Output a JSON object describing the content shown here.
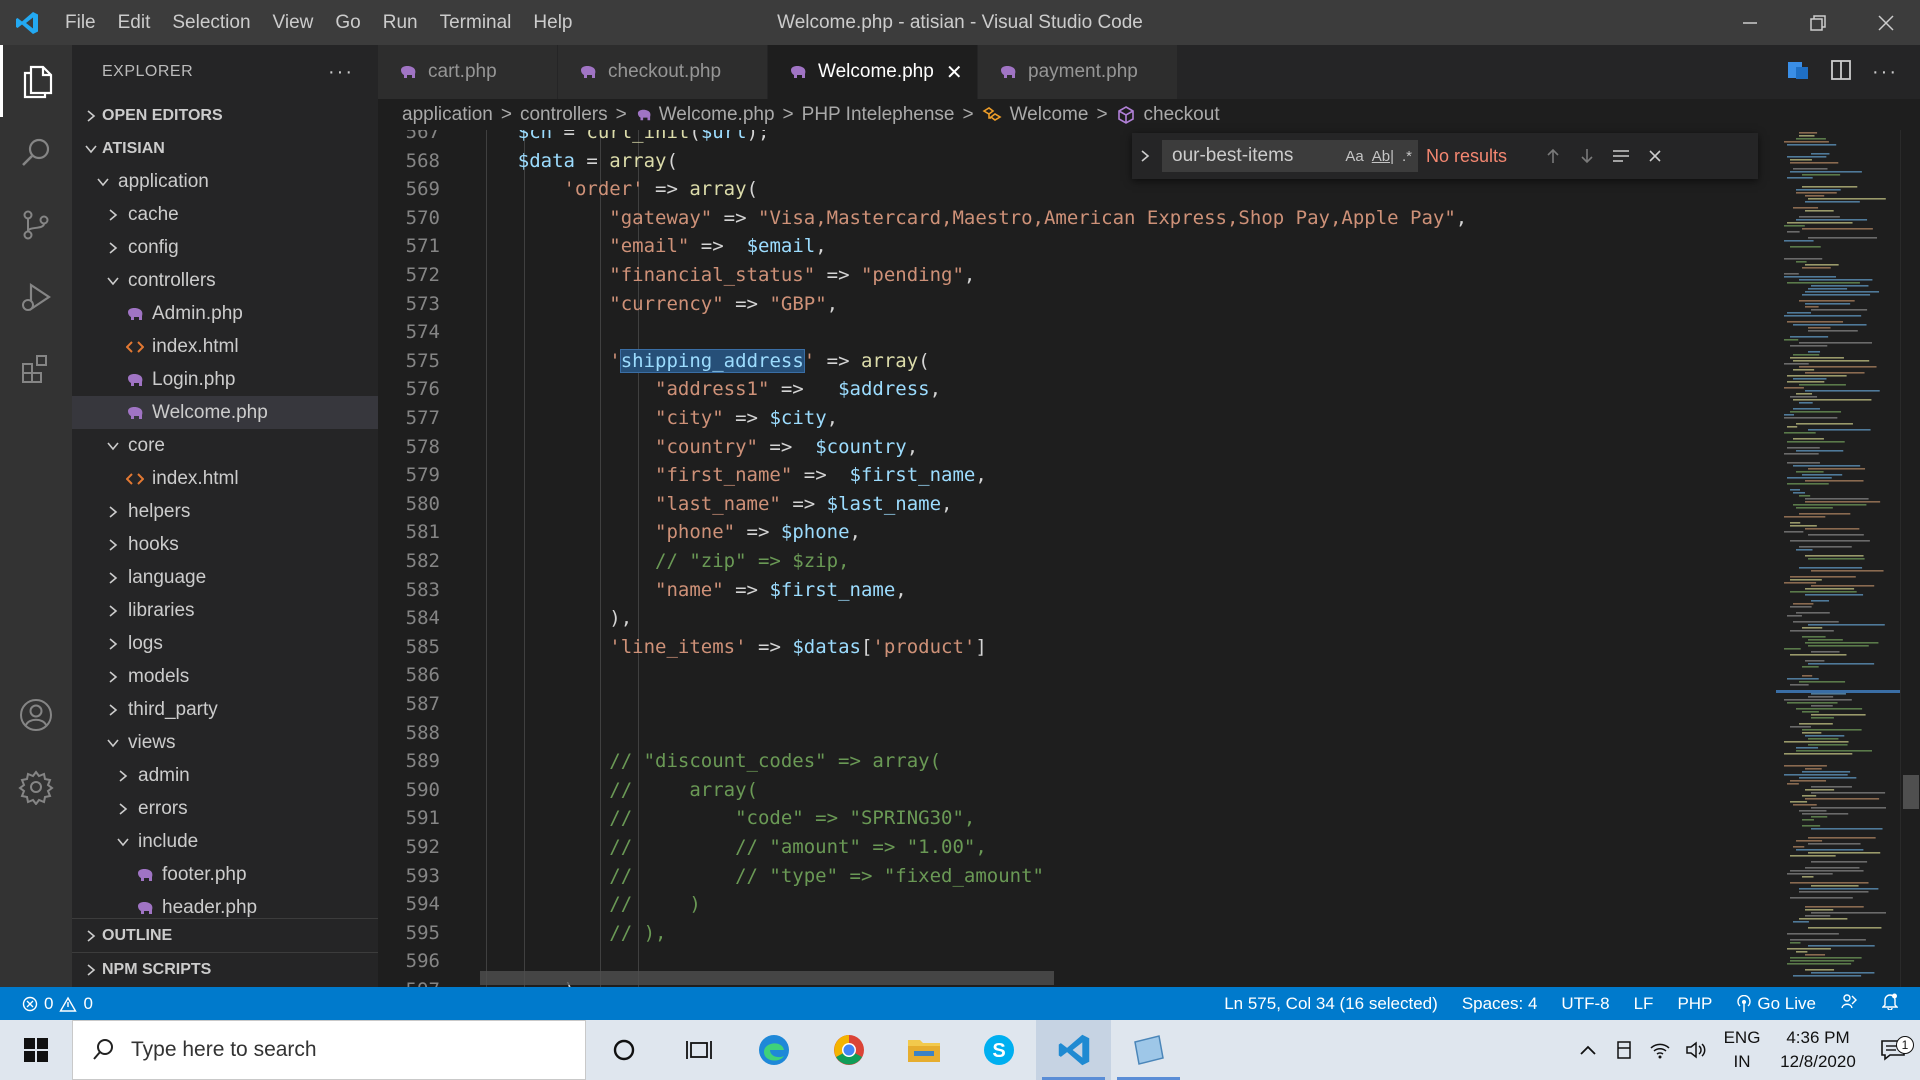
{
  "titlebar": {
    "menu": [
      "File",
      "Edit",
      "Selection",
      "View",
      "Go",
      "Run",
      "Terminal",
      "Help"
    ],
    "window_title": "Welcome.php - atisian - Visual Studio Code"
  },
  "sidebar": {
    "title": "EXPLORER",
    "more": "···",
    "open_editors": "OPEN EDITORS",
    "workspace": "ATISIAN",
    "tree": [
      {
        "label": "application",
        "depth": 0,
        "kind": "folder-open"
      },
      {
        "label": "cache",
        "depth": 1,
        "kind": "folder"
      },
      {
        "label": "config",
        "depth": 1,
        "kind": "folder"
      },
      {
        "label": "controllers",
        "depth": 1,
        "kind": "folder-open"
      },
      {
        "label": "Admin.php",
        "depth": 2,
        "kind": "php"
      },
      {
        "label": "index.html",
        "depth": 2,
        "kind": "html"
      },
      {
        "label": "Login.php",
        "depth": 2,
        "kind": "php"
      },
      {
        "label": "Welcome.php",
        "depth": 2,
        "kind": "php",
        "selected": true
      },
      {
        "label": "core",
        "depth": 1,
        "kind": "folder-open"
      },
      {
        "label": "index.html",
        "depth": 2,
        "kind": "html"
      },
      {
        "label": "helpers",
        "depth": 1,
        "kind": "folder"
      },
      {
        "label": "hooks",
        "depth": 1,
        "kind": "folder"
      },
      {
        "label": "language",
        "depth": 1,
        "kind": "folder"
      },
      {
        "label": "libraries",
        "depth": 1,
        "kind": "folder"
      },
      {
        "label": "logs",
        "depth": 1,
        "kind": "folder"
      },
      {
        "label": "models",
        "depth": 1,
        "kind": "folder"
      },
      {
        "label": "third_party",
        "depth": 1,
        "kind": "folder"
      },
      {
        "label": "views",
        "depth": 1,
        "kind": "folder-open"
      },
      {
        "label": "admin",
        "depth": 2,
        "kind": "folder"
      },
      {
        "label": "errors",
        "depth": 2,
        "kind": "folder"
      },
      {
        "label": "include",
        "depth": 2,
        "kind": "folder-open"
      },
      {
        "label": "footer.php",
        "depth": 3,
        "kind": "php"
      },
      {
        "label": "header.php",
        "depth": 3,
        "kind": "php"
      }
    ],
    "outline": "OUTLINE",
    "npm_scripts": "NPM SCRIPTS"
  },
  "tabs": [
    {
      "label": "cart.php",
      "active": false
    },
    {
      "label": "checkout.php",
      "active": false
    },
    {
      "label": "Welcome.php",
      "active": true
    },
    {
      "label": "payment.php",
      "active": false
    }
  ],
  "tab_close": "✕",
  "breadcrumbs": {
    "items": [
      "application",
      "controllers",
      "Welcome.php",
      "PHP Intelephense",
      "Welcome",
      "checkout"
    ],
    "separator": ">"
  },
  "find_widget": {
    "query": "our-best-items",
    "match_case": "Aa",
    "whole_word": "Ab|",
    "regex": ".*",
    "results": "No results"
  },
  "code": {
    "lines": [
      {
        "n": "567",
        "tokens": [
          [
            "pl",
            "    "
          ],
          [
            "var",
            "$ch"
          ],
          [
            "pl",
            " = "
          ],
          [
            "fn",
            "curl_init"
          ],
          [
            "pl",
            "("
          ],
          [
            "var",
            "$url"
          ],
          [
            "pl",
            ");"
          ]
        ],
        "top": true
      },
      {
        "n": "568",
        "tokens": [
          [
            "pl",
            "    "
          ],
          [
            "var",
            "$data"
          ],
          [
            "pl",
            " = "
          ],
          [
            "fn",
            "array"
          ],
          [
            "pl",
            "("
          ]
        ]
      },
      {
        "n": "569",
        "tokens": [
          [
            "pl",
            "        "
          ],
          [
            "str",
            "'order'"
          ],
          [
            "pl",
            " => "
          ],
          [
            "fn",
            "array"
          ],
          [
            "pl",
            "("
          ]
        ]
      },
      {
        "n": "570",
        "tokens": [
          [
            "pl",
            "            "
          ],
          [
            "str",
            "\"gateway\""
          ],
          [
            "pl",
            " => "
          ],
          [
            "str",
            "\"Visa,Mastercard,Maestro,American Express,Shop Pay,Apple Pay\""
          ],
          [
            "pl",
            ","
          ]
        ]
      },
      {
        "n": "571",
        "tokens": [
          [
            "pl",
            "            "
          ],
          [
            "str",
            "\"email\""
          ],
          [
            "pl",
            " =>  "
          ],
          [
            "var",
            "$email"
          ],
          [
            "pl",
            ","
          ]
        ]
      },
      {
        "n": "572",
        "tokens": [
          [
            "pl",
            "            "
          ],
          [
            "str",
            "\"financial_status\""
          ],
          [
            "pl",
            " => "
          ],
          [
            "str",
            "\"pending\""
          ],
          [
            "pl",
            ","
          ]
        ]
      },
      {
        "n": "573",
        "tokens": [
          [
            "pl",
            "            "
          ],
          [
            "str",
            "\"currency\""
          ],
          [
            "pl",
            " => "
          ],
          [
            "str",
            "\"GBP\""
          ],
          [
            "pl",
            ","
          ]
        ]
      },
      {
        "n": "574",
        "tokens": [
          [
            "pl",
            ""
          ]
        ]
      },
      {
        "n": "575",
        "tokens": [
          [
            "pl",
            "            "
          ],
          [
            "str",
            "'"
          ],
          [
            "sel",
            "shipping_address"
          ],
          [
            "str",
            "'"
          ],
          [
            "pl",
            " => "
          ],
          [
            "fn",
            "array"
          ],
          [
            "pl",
            "("
          ]
        ]
      },
      {
        "n": "576",
        "tokens": [
          [
            "pl",
            "                "
          ],
          [
            "str",
            "\"address1\""
          ],
          [
            "pl",
            " =>   "
          ],
          [
            "var",
            "$address"
          ],
          [
            "pl",
            ","
          ]
        ]
      },
      {
        "n": "577",
        "tokens": [
          [
            "pl",
            "                "
          ],
          [
            "str",
            "\"city\""
          ],
          [
            "pl",
            " => "
          ],
          [
            "var",
            "$city"
          ],
          [
            "pl",
            ","
          ]
        ]
      },
      {
        "n": "578",
        "tokens": [
          [
            "pl",
            "                "
          ],
          [
            "str",
            "\"country\""
          ],
          [
            "pl",
            " =>  "
          ],
          [
            "var",
            "$country"
          ],
          [
            "pl",
            ","
          ]
        ]
      },
      {
        "n": "579",
        "tokens": [
          [
            "pl",
            "                "
          ],
          [
            "str",
            "\"first_name\""
          ],
          [
            "pl",
            " =>  "
          ],
          [
            "var",
            "$first_name"
          ],
          [
            "pl",
            ","
          ]
        ]
      },
      {
        "n": "580",
        "tokens": [
          [
            "pl",
            "                "
          ],
          [
            "str",
            "\"last_name\""
          ],
          [
            "pl",
            " => "
          ],
          [
            "var",
            "$last_name"
          ],
          [
            "pl",
            ","
          ]
        ]
      },
      {
        "n": "581",
        "tokens": [
          [
            "pl",
            "                "
          ],
          [
            "str",
            "\"phone\""
          ],
          [
            "pl",
            " => "
          ],
          [
            "var",
            "$phone"
          ],
          [
            "pl",
            ","
          ]
        ]
      },
      {
        "n": "582",
        "tokens": [
          [
            "pl",
            "                "
          ],
          [
            "cmt",
            "// \"zip\" => $zip,"
          ]
        ]
      },
      {
        "n": "583",
        "tokens": [
          [
            "pl",
            "                "
          ],
          [
            "str",
            "\"name\""
          ],
          [
            "pl",
            " => "
          ],
          [
            "var",
            "$first_name"
          ],
          [
            "pl",
            ","
          ]
        ]
      },
      {
        "n": "584",
        "tokens": [
          [
            "pl",
            "            ),"
          ]
        ]
      },
      {
        "n": "585",
        "tokens": [
          [
            "pl",
            "            "
          ],
          [
            "str",
            "'line_items'"
          ],
          [
            "pl",
            " => "
          ],
          [
            "var",
            "$datas"
          ],
          [
            "pl",
            "["
          ],
          [
            "str",
            "'product'"
          ],
          [
            "pl",
            "]"
          ]
        ]
      },
      {
        "n": "586",
        "tokens": [
          [
            "pl",
            ""
          ]
        ]
      },
      {
        "n": "587",
        "tokens": [
          [
            "pl",
            ""
          ]
        ]
      },
      {
        "n": "588",
        "tokens": [
          [
            "pl",
            ""
          ]
        ]
      },
      {
        "n": "589",
        "tokens": [
          [
            "pl",
            "            "
          ],
          [
            "cmt",
            "// \"discount_codes\" => array("
          ]
        ]
      },
      {
        "n": "590",
        "tokens": [
          [
            "pl",
            "            "
          ],
          [
            "cmt",
            "//     array("
          ]
        ]
      },
      {
        "n": "591",
        "tokens": [
          [
            "pl",
            "            "
          ],
          [
            "cmt",
            "//         \"code\" => \"SPRING30\","
          ]
        ]
      },
      {
        "n": "592",
        "tokens": [
          [
            "pl",
            "            "
          ],
          [
            "cmt",
            "//         // \"amount\" => \"1.00\","
          ]
        ]
      },
      {
        "n": "593",
        "tokens": [
          [
            "pl",
            "            "
          ],
          [
            "cmt",
            "//         // \"type\" => \"fixed_amount\""
          ]
        ]
      },
      {
        "n": "594",
        "tokens": [
          [
            "pl",
            "            "
          ],
          [
            "cmt",
            "//     )"
          ]
        ]
      },
      {
        "n": "595",
        "tokens": [
          [
            "pl",
            "            "
          ],
          [
            "cmt",
            "// ),"
          ]
        ]
      },
      {
        "n": "596",
        "tokens": [
          [
            "pl",
            ""
          ]
        ]
      },
      {
        "n": "597",
        "tokens": [
          [
            "pl",
            "        ),"
          ]
        ]
      }
    ]
  },
  "statusbar": {
    "errors": "0",
    "warnings": "0",
    "position": "Ln 575, Col 34 (16 selected)",
    "spaces": "Spaces: 4",
    "encoding": "UTF-8",
    "eol": "LF",
    "language": "PHP",
    "go_live": "Go Live"
  },
  "taskbar": {
    "search_placeholder": "Type here to search",
    "lang_top": "ENG",
    "lang_bottom": "IN",
    "time": "4:36 PM",
    "date": "12/8/2020",
    "notifications": "1"
  },
  "colors": {
    "accent": "#007acc",
    "php_icon": "#a074c4",
    "html_icon": "#e37933"
  }
}
